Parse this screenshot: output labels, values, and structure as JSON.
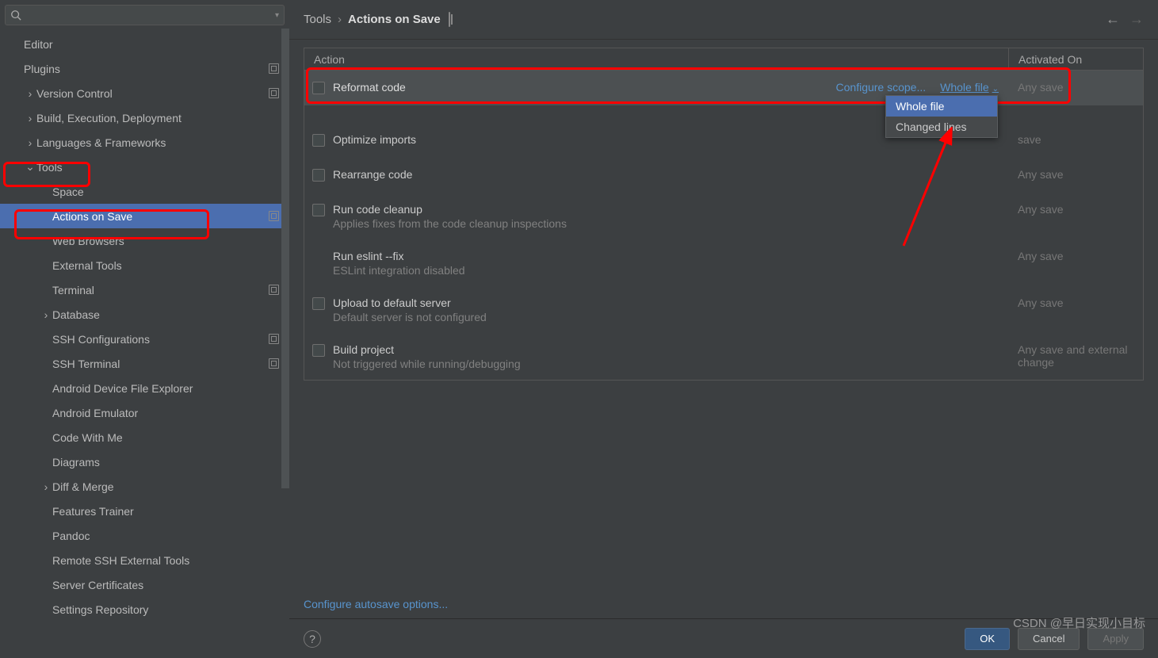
{
  "search": {
    "placeholder": ""
  },
  "breadcrumb": {
    "root": "Tools",
    "sep": "›",
    "page": "Actions on Save"
  },
  "sidebar": {
    "items": [
      {
        "label": "Editor",
        "indent": 1,
        "chev": false,
        "badge": false
      },
      {
        "label": "Plugins",
        "indent": 1,
        "chev": false,
        "badge": true
      },
      {
        "label": "Version Control",
        "indent": 1,
        "chev": true,
        "expanded": false,
        "badge": true
      },
      {
        "label": "Build, Execution, Deployment",
        "indent": 1,
        "chev": true,
        "expanded": false,
        "badge": false
      },
      {
        "label": "Languages & Frameworks",
        "indent": 1,
        "chev": true,
        "expanded": false,
        "badge": false
      },
      {
        "label": "Tools",
        "indent": 1,
        "chev": true,
        "expanded": true,
        "badge": false
      },
      {
        "label": "Space",
        "indent": 2,
        "chev": false,
        "badge": false
      },
      {
        "label": "Actions on Save",
        "indent": 2,
        "chev": false,
        "badge": true,
        "selected": true
      },
      {
        "label": "Web Browsers",
        "indent": 2,
        "chev": false,
        "badge": false
      },
      {
        "label": "External Tools",
        "indent": 2,
        "chev": false,
        "badge": false
      },
      {
        "label": "Terminal",
        "indent": 2,
        "chev": false,
        "badge": true
      },
      {
        "label": "Database",
        "indent": 2,
        "chev": true,
        "expanded": false,
        "badge": false
      },
      {
        "label": "SSH Configurations",
        "indent": 2,
        "chev": false,
        "badge": true
      },
      {
        "label": "SSH Terminal",
        "indent": 2,
        "chev": false,
        "badge": true
      },
      {
        "label": "Android Device File Explorer",
        "indent": 2,
        "chev": false,
        "badge": false
      },
      {
        "label": "Android Emulator",
        "indent": 2,
        "chev": false,
        "badge": false
      },
      {
        "label": "Code With Me",
        "indent": 2,
        "chev": false,
        "badge": false
      },
      {
        "label": "Diagrams",
        "indent": 2,
        "chev": false,
        "badge": false
      },
      {
        "label": "Diff & Merge",
        "indent": 2,
        "chev": true,
        "expanded": false,
        "badge": false
      },
      {
        "label": "Features Trainer",
        "indent": 2,
        "chev": false,
        "badge": false
      },
      {
        "label": "Pandoc",
        "indent": 2,
        "chev": false,
        "badge": false
      },
      {
        "label": "Remote SSH External Tools",
        "indent": 2,
        "chev": false,
        "badge": false
      },
      {
        "label": "Server Certificates",
        "indent": 2,
        "chev": false,
        "badge": false
      },
      {
        "label": "Settings Repository",
        "indent": 2,
        "chev": false,
        "badge": false
      }
    ]
  },
  "table": {
    "header_action": "Action",
    "header_activated": "Activated On",
    "rows": [
      {
        "title": "Reformat code",
        "activated": "Any save",
        "hover": true,
        "links": {
          "scope": "Configure scope...",
          "mode": "Whole file"
        }
      },
      {
        "title": "Optimize imports",
        "activated": "save"
      },
      {
        "title": "Rearrange code",
        "activated": "Any save"
      },
      {
        "title": "Run code cleanup",
        "sub": "Applies fixes from the code cleanup inspections",
        "activated": "Any save"
      },
      {
        "title": "Run eslint --fix",
        "sub": "ESLint integration disabled",
        "activated": "Any save",
        "nocb": true
      },
      {
        "title": "Upload to default server",
        "sub": "Default server is not configured",
        "activated": "Any save"
      },
      {
        "title": "Build project",
        "sub": "Not triggered while running/debugging",
        "activated": "Any save and external change"
      }
    ]
  },
  "popup": {
    "item1": "Whole file",
    "item2": "Changed lines"
  },
  "autosave_link": "Configure autosave options...",
  "buttons": {
    "ok": "OK",
    "cancel": "Cancel",
    "apply": "Apply"
  },
  "watermark": "CSDN @早日实现小目标"
}
